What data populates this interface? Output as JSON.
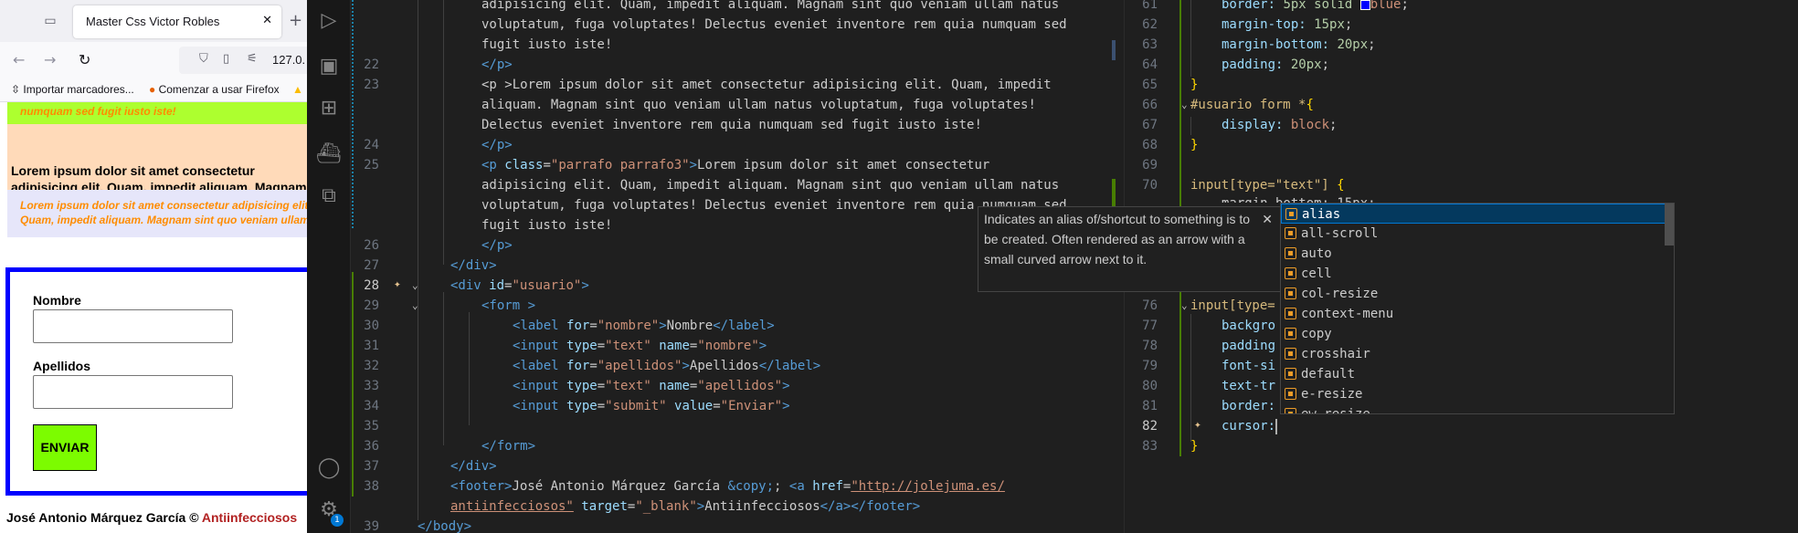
{
  "browser": {
    "tab_title": "Master Css Victor Robles",
    "tab_close": "✕",
    "new_tab": "+",
    "url": "127.0.",
    "bookmarks": [
      "Importar marcadores...",
      "Comenzar a usar Firefox"
    ],
    "page": {
      "lime_text": "numquam sed fugit iusto iste!",
      "peach_text": "Lorem ipsum dolor sit amet consectetur adipisicing elit. Quam, impedit aliquam. Magnam sint quo veniam ullam natus voluptatum, fuga voluptates! Delectus eveniet inventore rem quia numquam sed fugit iusto iste!",
      "lavender_text": "Lorem ipsum dolor sit amet consectetur adipisicing elit. Quam, impedit aliquam. Magnam sint quo veniam ullam natus voluptatum, fuga voluptates! Delectus eveniet inventore rem quia numquam sed fugit iusto iste!",
      "label_nombre": "Nombre",
      "label_apellidos": "Apellidos",
      "submit": "ENVIAR",
      "footer_text": "José Antonio Márquez García © ",
      "footer_link": "Antiinfecciosos"
    }
  },
  "colors": {
    "lime": "#adff2f",
    "peach": "#ffdab9",
    "lavender": "#e6e6fa",
    "form_border": "#0000ff",
    "submit_bg": "#7cfc00",
    "vscode_bg": "#1f1f1f",
    "suggest_selected": "#04395e"
  },
  "activity_icons": [
    "run-debug-icon",
    "remote-explorer-icon",
    "extensions-icon",
    "docker-icon",
    "live-share-icon",
    "account-icon",
    "settings-icon"
  ],
  "settings_badge": "1",
  "left_editor": {
    "line_numbers": [
      "22",
      "23",
      "24",
      "25",
      "26",
      "27",
      "28",
      "29",
      "30",
      "31",
      "32",
      "33",
      "34",
      "35",
      "36",
      "37",
      "38",
      "39"
    ],
    "wrapped_21": [
      "adipisicing elit. Quam, impedit aliquam. Magnam sint quo veniam ullam natus",
      "voluptatum, fuga voluptates! Delectus eveniet inventore rem quia numquam sed",
      "fugit iusto iste!"
    ],
    "l22": "</p>",
    "l23": [
      "<p >Lorem ipsum dolor sit amet consectetur adipisicing elit. Quam, impedit",
      "aliquam. Magnam sint quo veniam ullam natus voluptatum, fuga voluptates!",
      "Delectus eveniet inventore rem quia numquam sed fugit iusto iste!"
    ],
    "l24": "</p>",
    "l25_class": "\"parrafo parrafo3\"",
    "l25": [
      "Lorem ipsum dolor sit amet consectetur",
      "adipisicing elit. Quam, impedit aliquam. Magnam sint quo veniam ullam natus",
      "voluptatum, fuga voluptates! Delectus eveniet inventore rem quia numquam sed",
      "fugit iusto iste!"
    ],
    "l26": "</p>",
    "l27": "</div>",
    "l28_id": "\"usuario\"",
    "l29": "<form >",
    "l30_for": "\"nombre\"",
    "l30_text": "Nombre",
    "l31_type": "\"text\"",
    "l31_name": "\"nombre\"",
    "l32_for": "\"apellidos\"",
    "l32_text": "Apellidos",
    "l33_type": "\"text\"",
    "l33_name": "\"apellidos\"",
    "l34_type": "\"submit\"",
    "l34_value": "\"Enviar\"",
    "l36": "</form>",
    "l37": "</div>",
    "l38_text": "José Antonio Márquez García ",
    "l38_entity": "&copy;",
    "l38_href1": "\"http://jolejuma.es/",
    "l38_href2": "antiinfecciosos\"",
    "l38_target": "\"_blank\"",
    "l38_link": "Antiinfecciosos",
    "l39": "</body>"
  },
  "right_editor": {
    "line_numbers": [
      "61",
      "62",
      "63",
      "64",
      "65",
      "66",
      "67",
      "68",
      "69",
      "70",
      "76",
      "77",
      "78",
      "79",
      "80",
      "81",
      "82",
      "83"
    ],
    "l61_prop": "border:",
    "l61_val": "5px solid ",
    "l61_color": "blue",
    "l62_prop": "margin-top:",
    "l62_val": "15px",
    "l63_prop": "margin-bottom:",
    "l63_val": "20px",
    "l64_prop": "padding:",
    "l64_val": "20px",
    "l66_sel": "#usuario form *",
    "l67_prop": "display:",
    "l67_val": "block",
    "l70_sel": "input",
    "l70_attr": "[type=\"text\"]",
    "l71_partial": "margin-bottom: 15px;",
    "l76_partial": "input[type=",
    "l77": "backgro",
    "l78": "padding",
    "l79": "font-si",
    "l80": "text-tr",
    "l81": "border:",
    "l82": "cursor:"
  },
  "hover_doc": {
    "text": "Indicates an alias of/shortcut to something is to be created. Often rendered as an arrow with a small curved arrow next to it.",
    "close": "✕"
  },
  "suggestions": [
    "alias",
    "all-scroll",
    "auto",
    "cell",
    "col-resize",
    "context-menu",
    "copy",
    "crosshair",
    "default",
    "e-resize",
    "ew-resize"
  ]
}
